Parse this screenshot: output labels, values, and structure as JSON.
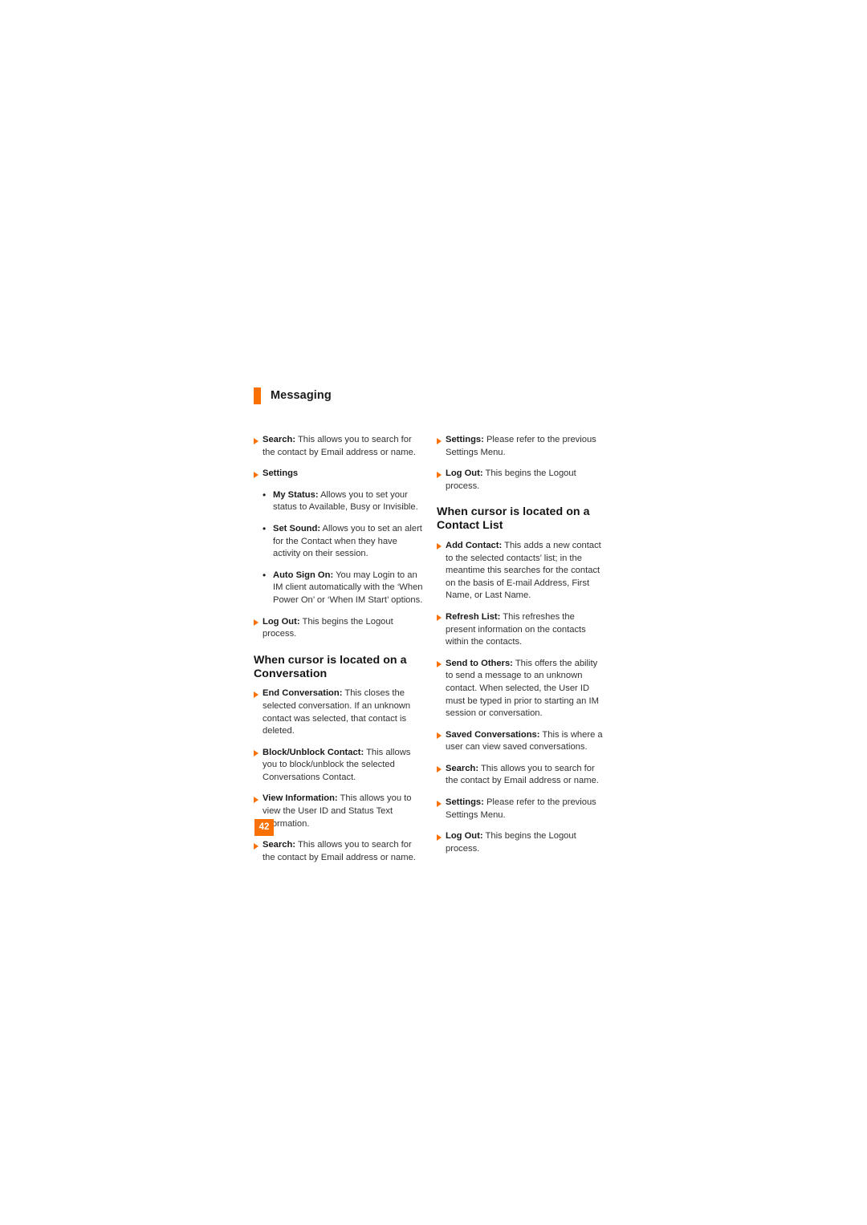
{
  "header": {
    "title": "Messaging",
    "accent_color": "#f97005"
  },
  "page_number": "42",
  "left_column": [
    {
      "kind": "tri",
      "lead": "Search:",
      "text": " This allows you to search for the contact by Email address or name."
    },
    {
      "kind": "tri",
      "lead": "Settings",
      "text": ""
    },
    {
      "kind": "dot",
      "lead": "My Status:",
      "text": " Allows you to set your status to Available, Busy or Invisible."
    },
    {
      "kind": "dot",
      "lead": "Set Sound:",
      "text": " Allows you to set an alert for the Contact when they have activity on their session."
    },
    {
      "kind": "dot",
      "lead": "Auto Sign On:",
      "text": " You may Login to an IM client automatically with the ‘When Power On’ or ‘When IM Start’ options."
    },
    {
      "kind": "tri",
      "lead": "Log Out:",
      "text": " This begins the Logout process."
    },
    {
      "kind": "subhead",
      "text": "When cursor is located on a Conversation"
    },
    {
      "kind": "tri",
      "lead": "End Conversation:",
      "text": " This closes the selected conversation. If an unknown contact was selected, that contact is deleted."
    },
    {
      "kind": "tri",
      "lead": "Block/Unblock Contact:",
      "text": " This allows you to block/unblock the selected Conversations Contact."
    },
    {
      "kind": "tri",
      "lead": "View Information:",
      "text": " This allows you to view the User ID and Status Text information."
    },
    {
      "kind": "tri",
      "lead": "Search:",
      "text": " This allows you to search for the contact by Email address or name."
    }
  ],
  "right_column": [
    {
      "kind": "tri",
      "lead": "Settings:",
      "text": " Please refer to the previous Settings Menu."
    },
    {
      "kind": "tri",
      "lead": "Log Out:",
      "text": " This begins the Logout process."
    },
    {
      "kind": "subhead",
      "text": "When cursor is located on a Contact List"
    },
    {
      "kind": "tri",
      "lead": "Add Contact:",
      "text": " This adds a new contact to the selected contacts’ list; in the meantime this searches for the contact on the basis of E-mail Address, First Name, or Last Name."
    },
    {
      "kind": "tri",
      "lead": "Refresh List:",
      "text": " This refreshes the present information on the contacts within the contacts."
    },
    {
      "kind": "tri",
      "lead": "Send to Others:",
      "text": " This offers the ability to send a message to an unknown contact. When selected, the User ID must be typed in prior to starting an IM session or conversation."
    },
    {
      "kind": "tri",
      "lead": "Saved Conversations:",
      "text": " This is where a user can view saved conversations."
    },
    {
      "kind": "tri",
      "lead": "Search:",
      "text": " This allows you to search for the contact by Email address or name."
    },
    {
      "kind": "tri",
      "lead": "Settings:",
      "text": " Please refer to the previous Settings Menu."
    },
    {
      "kind": "tri",
      "lead": "Log Out:",
      "text": " This begins the Logout process."
    }
  ]
}
